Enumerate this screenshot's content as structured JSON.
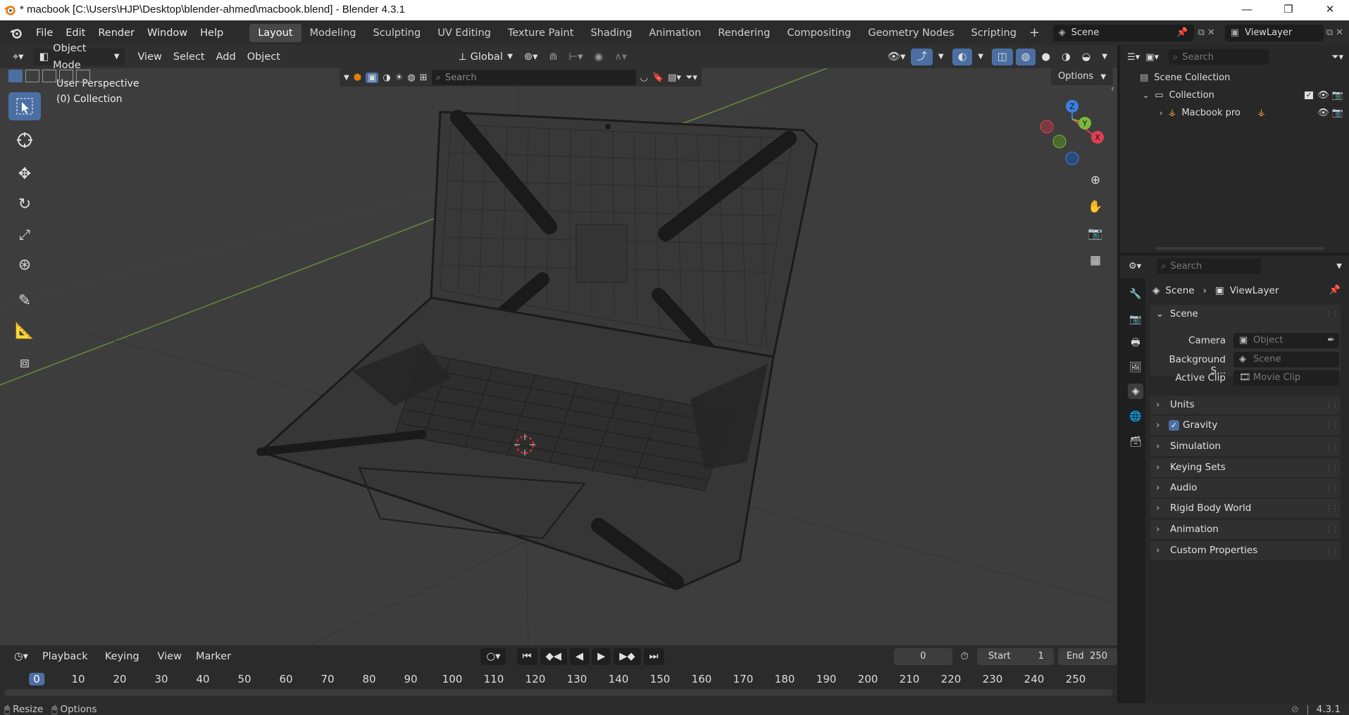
{
  "window": {
    "title": "* macbook [C:\\Users\\HJP\\Desktop\\blender-ahmed\\macbook.blend] - Blender 4.3.1",
    "minimize_glyph": "—",
    "maximize_glyph": "❐",
    "close_glyph": "✕"
  },
  "menu": [
    "File",
    "Edit",
    "Render",
    "Window",
    "Help"
  ],
  "workspaces": [
    {
      "label": "Layout",
      "active": true
    },
    {
      "label": "Modeling"
    },
    {
      "label": "Sculpting"
    },
    {
      "label": "UV Editing"
    },
    {
      "label": "Texture Paint"
    },
    {
      "label": "Shading"
    },
    {
      "label": "Animation"
    },
    {
      "label": "Rendering"
    },
    {
      "label": "Compositing"
    },
    {
      "label": "Geometry Nodes"
    },
    {
      "label": "Scripting"
    }
  ],
  "add_workspace_glyph": "+",
  "scene_field": "Scene",
  "viewlayer_field": "ViewLayer",
  "viewport_header": {
    "mode": "Object Mode",
    "menus": [
      "View",
      "Select",
      "Add",
      "Object"
    ],
    "transform_orientation": "Global",
    "search_placeholder": "Search",
    "options_label": "Options"
  },
  "viewport": {
    "perspective": "User Perspective",
    "collection": "(0) Collection",
    "gizmo": {
      "x": "X",
      "y": "Y",
      "z": "Z"
    }
  },
  "outliner": {
    "search_placeholder": "Search",
    "scene_collection": "Scene Collection",
    "collection": "Collection",
    "object": "Macbook pro"
  },
  "properties": {
    "search_placeholder": "Search",
    "breadcrumb_scene": "Scene",
    "breadcrumb_viewlayer": "ViewLayer",
    "scene_panel": "Scene",
    "camera_label": "Camera",
    "camera_placeholder": "Object",
    "background_label": "Background S...",
    "background_placeholder": "Scene",
    "clip_label": "Active Clip",
    "clip_placeholder": "Movie Clip",
    "panels": [
      "Units",
      "Gravity",
      "Simulation",
      "Keying Sets",
      "Audio",
      "Rigid Body World",
      "Animation",
      "Custom Properties"
    ],
    "gravity_checked": true
  },
  "timeline": {
    "menus": [
      "Playback",
      "Keying",
      "View",
      "Marker"
    ],
    "current_frame": "0",
    "start_label": "Start",
    "start_value": "1",
    "end_label": "End",
    "end_value": "250",
    "ticks": [
      "0",
      "10",
      "20",
      "30",
      "40",
      "50",
      "60",
      "70",
      "80",
      "90",
      "100",
      "110",
      "120",
      "130",
      "140",
      "150",
      "160",
      "170",
      "180",
      "190",
      "200",
      "210",
      "220",
      "230",
      "240",
      "250"
    ]
  },
  "statusbar": {
    "resize": "Resize",
    "options": "Options",
    "version": "4.3.1"
  },
  "colors": {
    "accent": "#4c6fa3",
    "viewport_bg": "#3d3d3d",
    "x_axis": "#e04050",
    "y_axis": "#7bb83c",
    "z_axis": "#3d7fe0"
  }
}
